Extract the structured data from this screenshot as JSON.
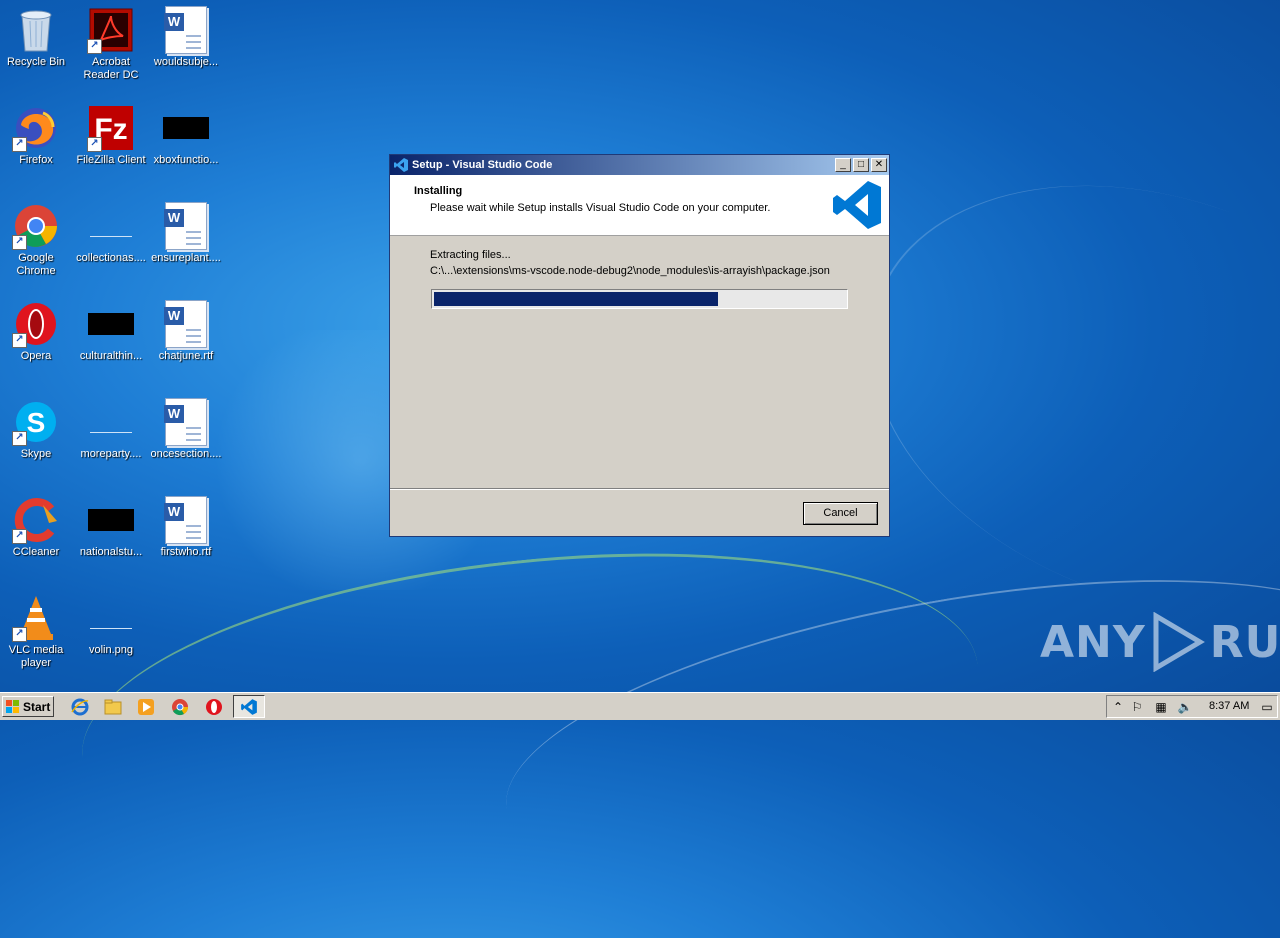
{
  "desktop": {
    "icons": [
      {
        "label": "Recycle Bin",
        "icon": "recycle-bin-icon"
      },
      {
        "label": "Acrobat Reader DC",
        "icon": "acrobat-icon"
      },
      {
        "label": "wouldsubje...",
        "icon": "word-doc-icon"
      },
      {
        "label": "Firefox",
        "icon": "firefox-icon"
      },
      {
        "label": "FileZilla Client",
        "icon": "filezilla-icon"
      },
      {
        "label": "xboxfunctio...",
        "icon": "black-file-icon"
      },
      {
        "label": "Google Chrome",
        "icon": "chrome-icon"
      },
      {
        "label": "collectionas....",
        "icon": "blank-file-icon"
      },
      {
        "label": "ensureplant....",
        "icon": "word-doc-icon"
      },
      {
        "label": "Opera",
        "icon": "opera-icon"
      },
      {
        "label": "culturalthin...",
        "icon": "black-file-icon"
      },
      {
        "label": "chatjune.rtf",
        "icon": "word-doc-icon"
      },
      {
        "label": "Skype",
        "icon": "skype-icon"
      },
      {
        "label": "moreparty....",
        "icon": "blank-file-icon"
      },
      {
        "label": "oncesection....",
        "icon": "word-doc-icon"
      },
      {
        "label": "CCleaner",
        "icon": "ccleaner-icon"
      },
      {
        "label": "nationalstu...",
        "icon": "black-file-icon"
      },
      {
        "label": "firstwho.rtf",
        "icon": "word-doc-icon"
      },
      {
        "label": "VLC media player",
        "icon": "vlc-icon"
      },
      {
        "label": "volin.png",
        "icon": "blank-file-icon"
      }
    ]
  },
  "setup": {
    "title": "Setup - Visual Studio Code",
    "heading": "Installing",
    "subheading": "Please wait while Setup installs Visual Studio Code on your computer.",
    "status": "Extracting files...",
    "path": "C:\\...\\extensions\\ms-vscode.node-debug2\\node_modules\\is-arrayish\\package.json",
    "progress_percent": 69,
    "cancel_label": "Cancel",
    "minimize_glyph": "_",
    "maximize_glyph": "□",
    "close_glyph": "✕"
  },
  "taskbar": {
    "start_label": "Start",
    "clock": "8:37 AM",
    "quick_launch": [
      "ie-icon",
      "explorer-icon",
      "media-player-icon",
      "chrome-icon",
      "opera-icon"
    ],
    "active_task": "vscode-icon"
  },
  "watermark": {
    "left": "ANY",
    "right": "RUN"
  },
  "colors": {
    "title_gradient_start": "#0a246a",
    "progress_fill": "#0a246a",
    "vscode_blue": "#0078d4"
  }
}
